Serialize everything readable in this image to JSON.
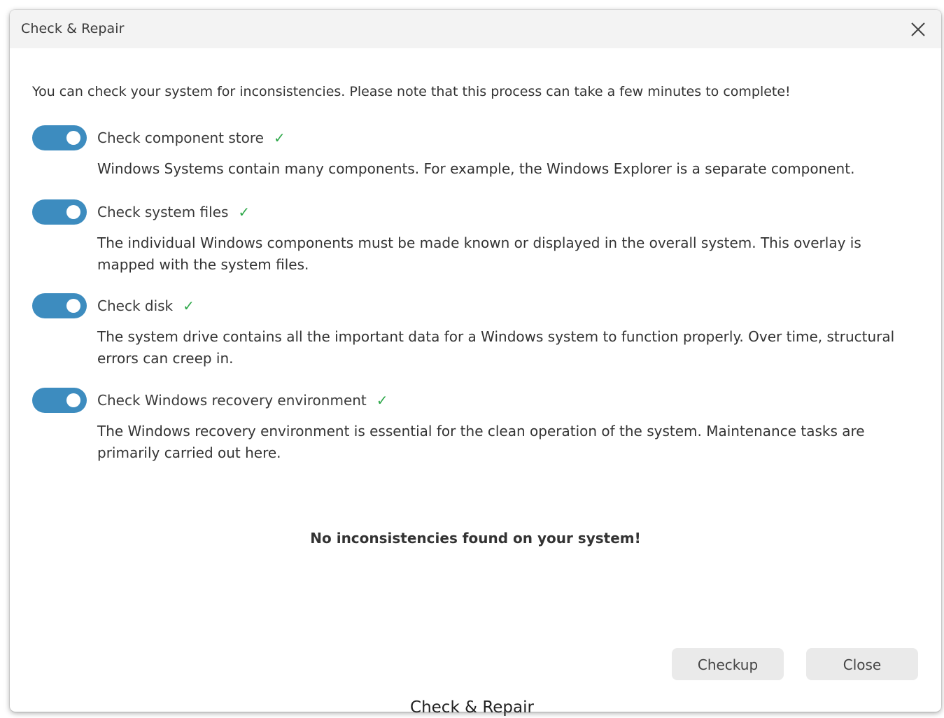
{
  "window": {
    "title": "Check & Repair"
  },
  "intro_text": "You can check your system for inconsistencies. Please note that this process can take a few minutes to complete!",
  "options": [
    {
      "label": "Check component store",
      "enabled": true,
      "status": "✓",
      "description": "Windows Systems contain many components. For example, the Windows Explorer is a separate component."
    },
    {
      "label": "Check system files",
      "enabled": true,
      "status": "✓",
      "description": "The individual Windows components must be made known or displayed in the overall system. This overlay is mapped with the system files."
    },
    {
      "label": "Check disk",
      "enabled": true,
      "status": "✓",
      "description": "The system drive contains all the important data for a Windows system to function properly. Over time, structural errors can creep in."
    },
    {
      "label": "Check Windows recovery environment",
      "enabled": true,
      "status": "✓",
      "description": "The Windows recovery environment is essential for the clean operation of the system. Maintenance tasks are primarily carried out here."
    }
  ],
  "result_text": "No inconsistencies found on your system!",
  "buttons": {
    "checkup": "Checkup",
    "close": "Close"
  },
  "caption": "Check & Repair",
  "colors": {
    "toggle_on": "#3d8cbf",
    "check_mark": "#2ea84a",
    "titlebar_bg": "#f3f3f3",
    "button_bg": "#eaeaea"
  },
  "icons": {
    "close": "close-icon",
    "check": "checkmark-icon"
  }
}
